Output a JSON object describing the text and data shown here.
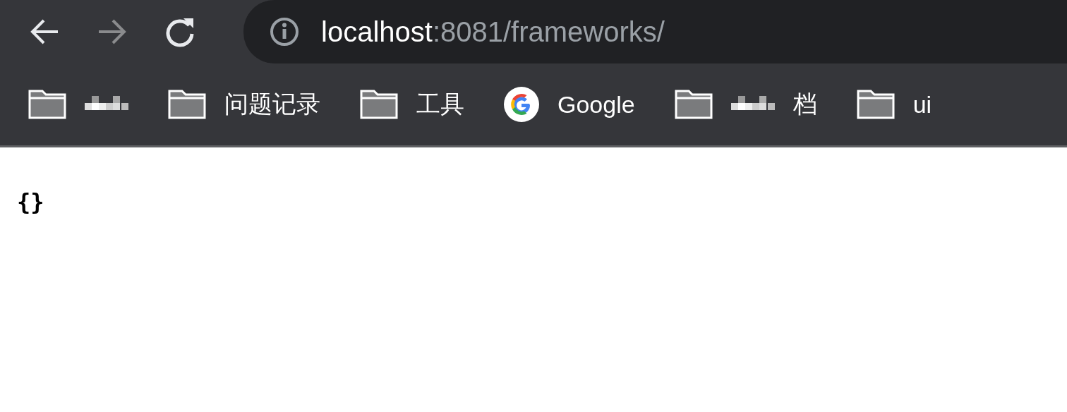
{
  "toolbar": {
    "back": {
      "disabled": false
    },
    "forward": {
      "disabled": true
    },
    "url": {
      "host": "localhost",
      "rest": ":8081/frameworks/"
    }
  },
  "bookmarks": [
    {
      "kind": "folder",
      "redacted": true
    },
    {
      "kind": "folder",
      "label": "问题记录"
    },
    {
      "kind": "folder",
      "label": "工具"
    },
    {
      "kind": "site",
      "label": "Google"
    },
    {
      "kind": "folder",
      "redacted": true,
      "label": "档"
    },
    {
      "kind": "folder",
      "label": "ui"
    }
  ],
  "page": {
    "text": "{}"
  }
}
